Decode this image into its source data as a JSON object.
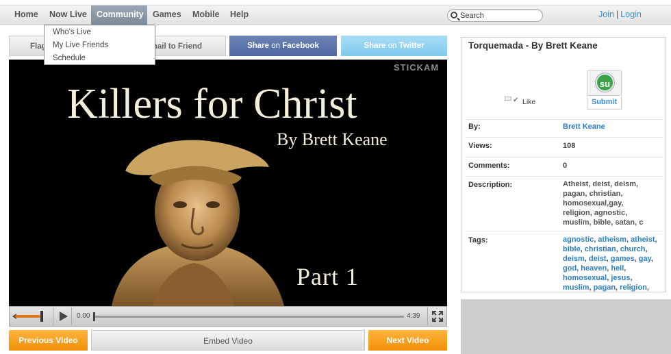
{
  "nav": {
    "items": [
      {
        "label": "Home",
        "active": false
      },
      {
        "label": "Now Live",
        "active": false
      },
      {
        "label": "Community",
        "active": true
      },
      {
        "label": "Games",
        "active": false
      },
      {
        "label": "Mobile",
        "active": false
      },
      {
        "label": "Help",
        "active": false
      }
    ],
    "search_placeholder": "Search",
    "join": "Join",
    "separator": "|",
    "login": "Login"
  },
  "community_menu": [
    "Who's Live",
    "My Live Friends",
    "Schedule"
  ],
  "share": {
    "flag": "Flag",
    "email": "Email to Friend",
    "facebook_bold": "Share",
    "facebook_thin": "on",
    "facebook_brand": "Facebook",
    "twitter_bold": "Share",
    "twitter_thin": "on",
    "twitter_brand": "Twitter"
  },
  "video": {
    "title": "Killers for Christ",
    "author": "By Brett Keane",
    "part": "Part 1",
    "brand": "STICKAM",
    "current_time": "0.00",
    "total_time": "4:39",
    "progress": 0,
    "volume": 0.85
  },
  "buttons": {
    "previous": "Previous Video",
    "embed": "Embed Video",
    "next": "Next Video"
  },
  "info": {
    "title": "Torquemada - By Brett Keane",
    "like": "Like",
    "submit": "Submit",
    "stumbleupon": "su",
    "by_label": "By:",
    "by_value": "Brett Keane",
    "views_label": "Views:",
    "views_value": "108",
    "comments_label": "Comments:",
    "comments_value": "0",
    "description_label": "Description:",
    "description_lines": [
      "Atheist, deist, deism,",
      "pagan, christian,",
      "homosexual,gay,",
      "religion, agnostic,",
      "muslim, bible, satan, c"
    ],
    "tags_label": "Tags:",
    "tags": [
      "agnostic",
      "atheism",
      "atheist",
      "bible",
      "christian",
      "church",
      "deism",
      "deist",
      "games",
      "gay",
      "god",
      "heaven",
      "hell",
      "homosexual",
      "jesus",
      "muslim",
      "pagan",
      "religion"
    ]
  },
  "colors": {
    "accent_blue": "#3b8fd0",
    "facebook": "#5670a8",
    "twitter": "#8fd2f1",
    "orange": "#f4a020",
    "stumbleupon_green": "#3aa34a"
  }
}
